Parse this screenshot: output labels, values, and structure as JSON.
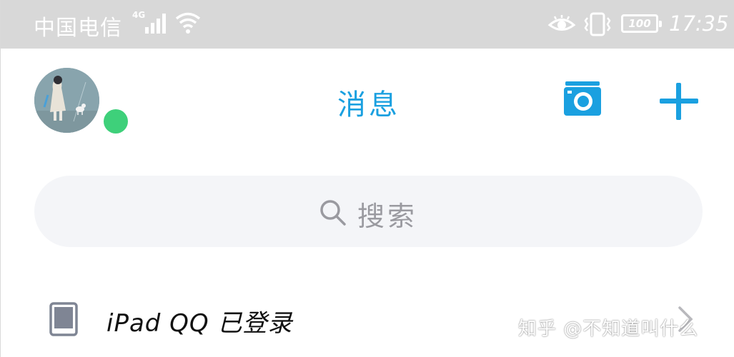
{
  "status_bar": {
    "carrier": "中国电信",
    "network_type": "4G",
    "battery_level": "100",
    "time": "17:35",
    "icons": [
      "signal-icon",
      "wifi-icon",
      "eye-icon",
      "vibrate-icon",
      "battery-icon"
    ]
  },
  "header": {
    "title": "消息",
    "online_status_color": "#3ed07a",
    "accent_color": "#1aa0e0",
    "icons": [
      "camera-icon",
      "plus-icon"
    ]
  },
  "search": {
    "placeholder": "搜索",
    "icon": "search-icon"
  },
  "device_row": {
    "label": "iPad QQ 已登录",
    "icon": "tablet-icon",
    "trailing_icon": "chevron-right-icon"
  },
  "watermark": {
    "text": "知乎 @不知道叫什么"
  }
}
